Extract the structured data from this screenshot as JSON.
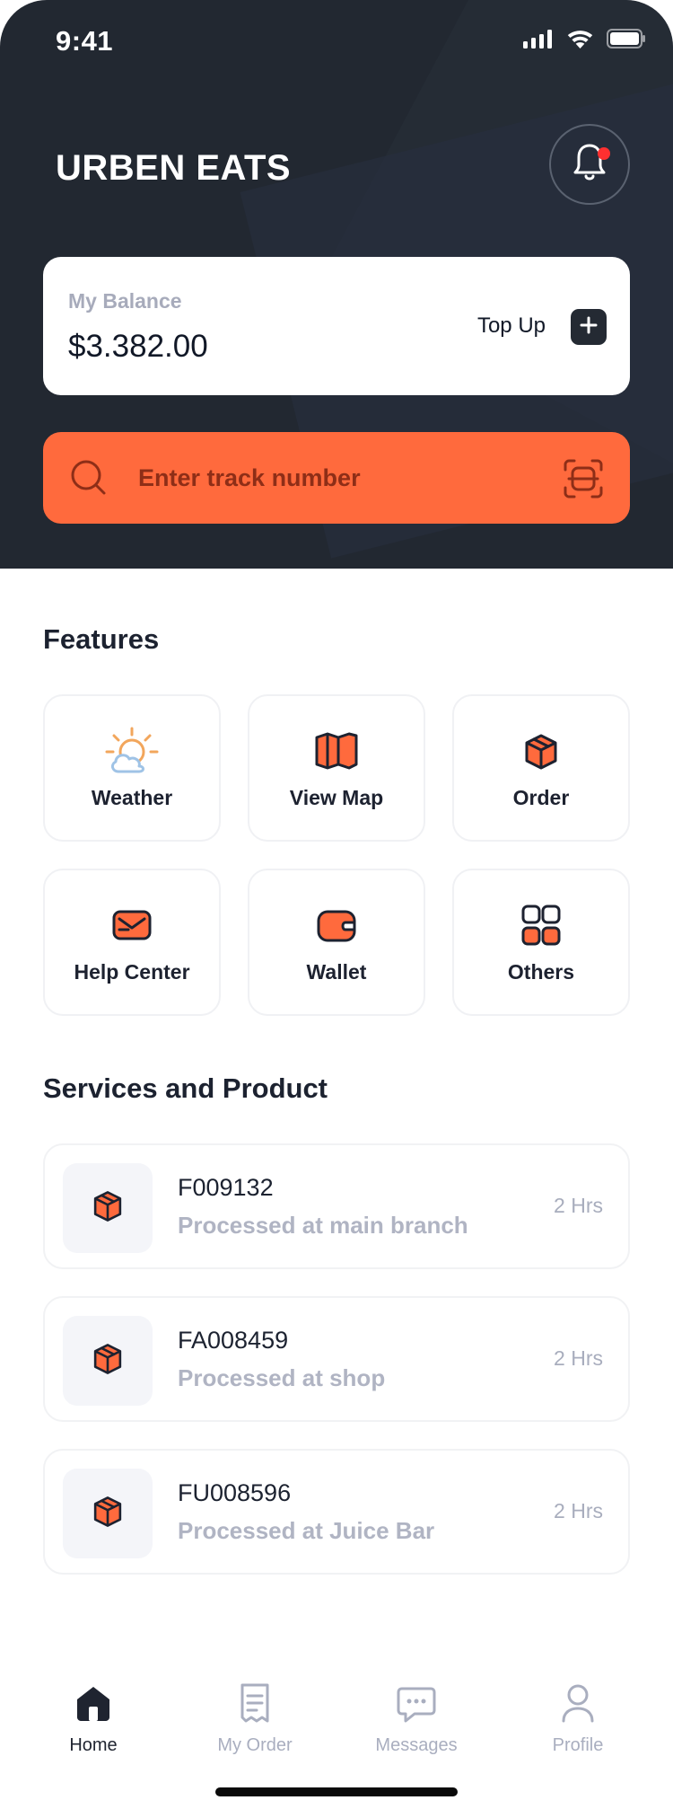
{
  "status": {
    "time": "9:41"
  },
  "header": {
    "title": "URBEN EATS",
    "balance_label": "My Balance",
    "balance_value": "$3.382.00",
    "topup_label": "Top Up",
    "search_placeholder": "Enter track number"
  },
  "features": {
    "title": "Features",
    "items": [
      {
        "label": "Weather",
        "icon": "weather-icon"
      },
      {
        "label": "View Map",
        "icon": "map-icon"
      },
      {
        "label": "Order",
        "icon": "box-icon"
      },
      {
        "label": "Help Center",
        "icon": "help-icon"
      },
      {
        "label": "Wallet",
        "icon": "wallet-icon"
      },
      {
        "label": "Others",
        "icon": "grid-icon"
      }
    ]
  },
  "services": {
    "title": "Services and Product",
    "items": [
      {
        "code": "F009132",
        "status": "Processed at  main branch",
        "time": "2 Hrs"
      },
      {
        "code": "FA008459",
        "status": "Processed at  shop",
        "time": "2 Hrs"
      },
      {
        "code": "FU008596",
        "status": "Processed at Juice Bar",
        "time": "2 Hrs"
      }
    ]
  },
  "nav": {
    "items": [
      {
        "label": "Home",
        "icon": "home-icon"
      },
      {
        "label": "My Order",
        "icon": "receipt-icon"
      },
      {
        "label": "Messages",
        "icon": "chat-icon"
      },
      {
        "label": "Profile",
        "icon": "user-icon"
      }
    ]
  },
  "colors": {
    "header_bg": "#222831",
    "accent": "#ff6a3d",
    "muted_text": "#a7abbb"
  }
}
